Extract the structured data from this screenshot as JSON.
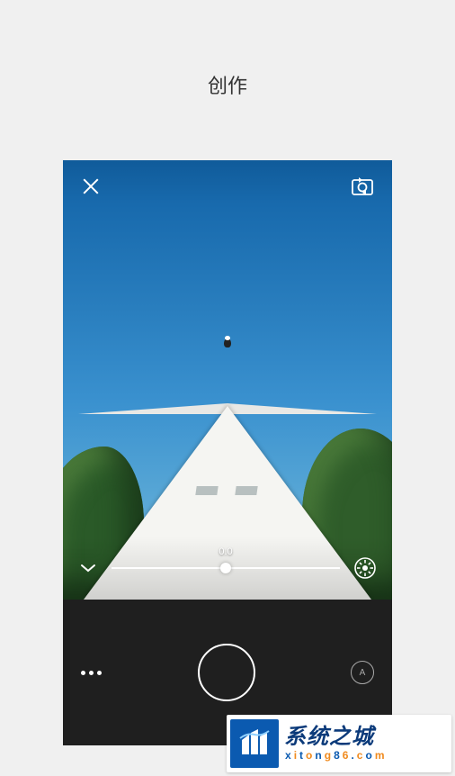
{
  "page": {
    "title": "创作"
  },
  "camera": {
    "top": {
      "close_label": "close",
      "switch_label": "switch-camera"
    },
    "exposure": {
      "value_label": "0.0",
      "value": 0.0,
      "min": -2.0,
      "max": 2.0
    },
    "controls": {
      "more_label": "more",
      "shutter_label": "shutter",
      "mode_label": "A"
    }
  },
  "watermark": {
    "title": "系统之城",
    "url_parts": [
      "x",
      "i",
      "t",
      "o",
      "n",
      "g",
      "8",
      "6",
      ".",
      "c",
      "o",
      "m"
    ]
  }
}
